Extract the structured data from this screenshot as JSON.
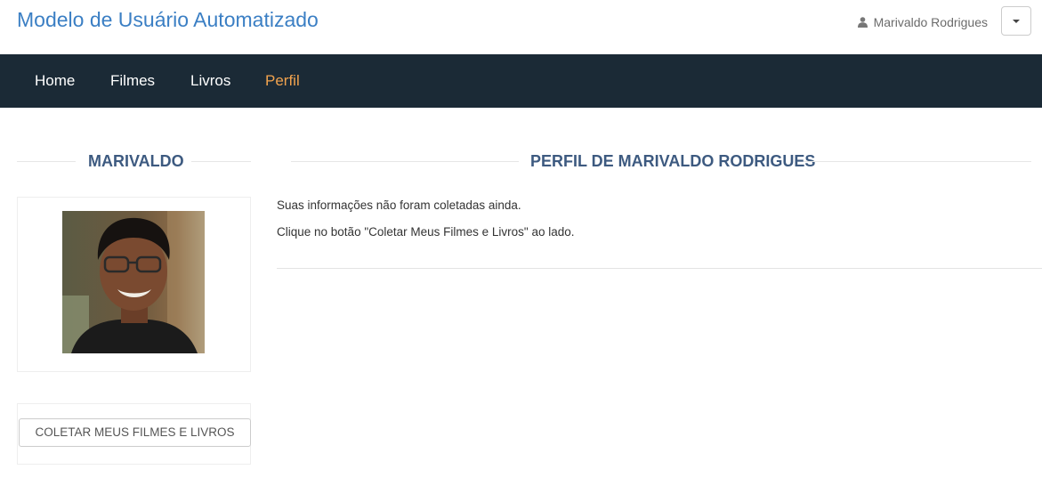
{
  "header": {
    "brand": "Modelo de Usuário Automatizado",
    "user_name": "Marivaldo Rodrigues"
  },
  "nav": {
    "items": [
      {
        "label": "Home",
        "active": false
      },
      {
        "label": "Filmes",
        "active": false
      },
      {
        "label": "Livros",
        "active": false
      },
      {
        "label": "Perfil",
        "active": true
      }
    ]
  },
  "sidebar": {
    "heading": "Marivaldo",
    "collect_button_label": "Coletar Meus Filmes e Livros"
  },
  "main": {
    "heading": "Perfil de Marivaldo Rodrigues",
    "messages": [
      "Suas informações não foram coletadas ainda.",
      "Clique no botão \"Coletar Meus Filmes e Livros\" ao lado."
    ]
  },
  "colors": {
    "brand": "#3b7fc4",
    "navbar_bg": "#1b2a36",
    "nav_active": "#f0a24e",
    "heading": "#3d5a80"
  },
  "icons": {
    "user": "user-icon",
    "dropdown": "caret-down-icon"
  }
}
